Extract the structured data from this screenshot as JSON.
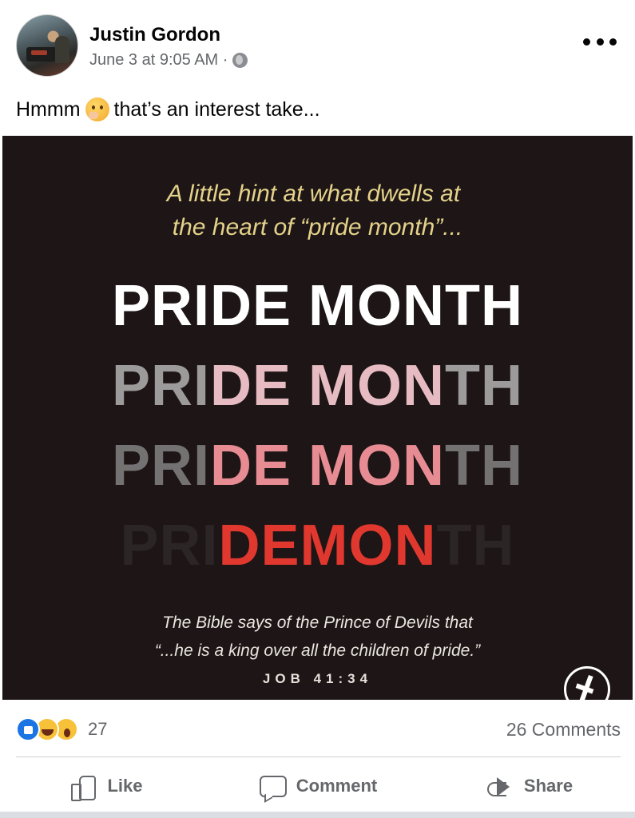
{
  "post": {
    "author": "Justin Gordon",
    "timestamp": "June 3 at 9:05 AM ·",
    "privacy_icon": "globe-icon",
    "more_icon": "more-options-icon",
    "caption_before": "Hmmm",
    "caption_emoji": "thinking-face-emoji",
    "caption_after": "that’s an interest take..."
  },
  "image": {
    "hint_line1": "A little hint at what dwells at",
    "hint_line2": "the heart of “pride month”...",
    "row1": "PRIDE MONTH",
    "row2": {
      "a": "PRI",
      "b": "DE ",
      "c": "MON",
      "d": "TH"
    },
    "row3": {
      "a": "PRI",
      "b": "DE",
      "c": "MON",
      "d": "TH"
    },
    "row4": {
      "a": "PRI",
      "b": "DEMON",
      "c": "TH"
    },
    "bible_line1": "The Bible says of the Prince of Devils that",
    "bible_line2": "“...he is a king over all the children of pride.”",
    "reference": "JOB 41:34",
    "colors": {
      "background": "#1d1516",
      "hint": "#e4d28a",
      "red": "#e0382e"
    }
  },
  "stats": {
    "reaction_icons": [
      "like-reaction-icon",
      "haha-reaction-icon",
      "wow-reaction-icon"
    ],
    "reaction_count": "27",
    "comments": "26 Comments"
  },
  "actions": {
    "like": "Like",
    "comment": "Comment",
    "share": "Share"
  }
}
